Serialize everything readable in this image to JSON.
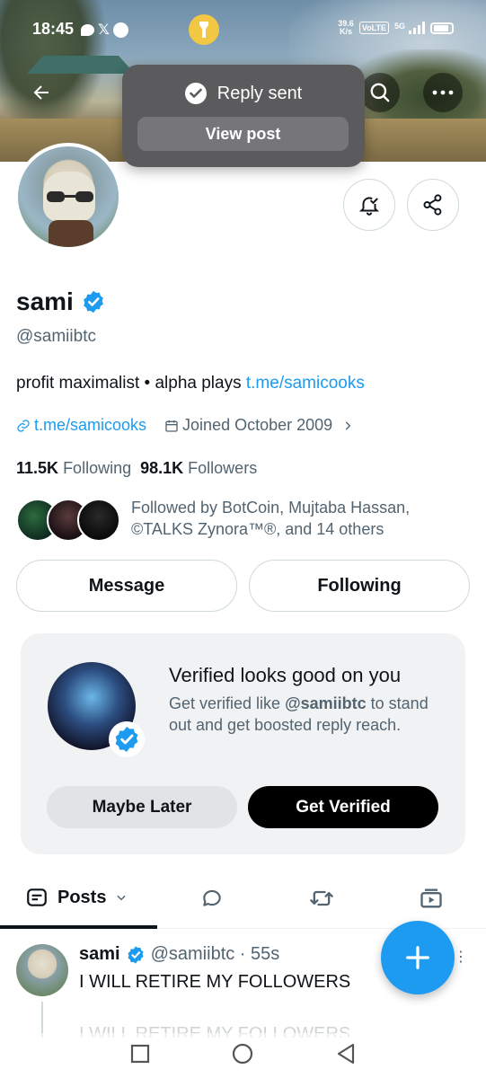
{
  "status_bar": {
    "time": "18:45",
    "net_speed_value": "39.6",
    "net_speed_unit": "K/s",
    "volte": "VoLTE",
    "network": "5G"
  },
  "toast": {
    "message": "Reply sent",
    "action_label": "View post"
  },
  "profile": {
    "name": "sami",
    "handle": "@samiibtc",
    "bio_text": "profit maximalist • alpha plays ",
    "bio_link": "t.me/samicooks",
    "website": "t.me/samicooks",
    "joined": "Joined October 2009",
    "following_count": "11.5K",
    "following_label": "Following",
    "followers_count": "98.1K",
    "followers_label": "Followers",
    "followed_by": "Followed by BotCoin, Mujtaba Hassan, ©TALKS Zynora™®, and 14 others"
  },
  "actions": {
    "message_label": "Message",
    "following_label": "Following"
  },
  "verify_card": {
    "title": "Verified looks good on you",
    "body_prefix": "Get verified like ",
    "body_handle": "@samiibtc",
    "body_suffix": " to stand out and get boosted reply reach.",
    "maybe_label": "Maybe Later",
    "get_verified_label": "Get Verified"
  },
  "tabs": {
    "posts_label": "Posts"
  },
  "post": {
    "name": "sami",
    "handle_time": "@samiibtc · 55s",
    "text": "I WILL RETIRE MY FOLLOWERS",
    "ghost_text": "I WILL RETIRE MY FOLLOWERS"
  },
  "colors": {
    "accent": "#1d9bf0",
    "toast_bg": "#5b5b5e",
    "text_secondary": "#536471"
  },
  "icons": {
    "back": "arrow-left-icon",
    "search": "search-icon",
    "more": "more-dots-icon",
    "notify": "bell-check-icon",
    "share": "share-icon",
    "link": "link-icon",
    "calendar": "calendar-icon",
    "verified": "verified-badge-icon",
    "compose": "plus-icon"
  }
}
